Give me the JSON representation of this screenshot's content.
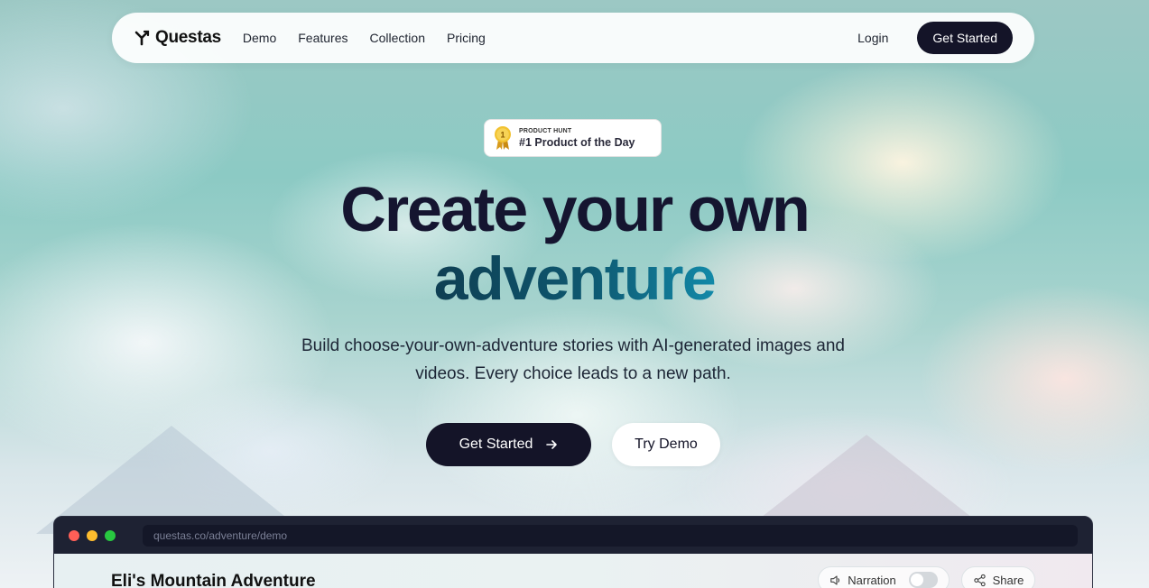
{
  "nav": {
    "logo_text": "Questas",
    "links": [
      "Demo",
      "Features",
      "Collection",
      "Pricing"
    ],
    "login": "Login",
    "cta": "Get Started"
  },
  "badge": {
    "small": "PRODUCT HUNT",
    "big": "#1 Product of the Day",
    "medal_number": "1"
  },
  "hero": {
    "title_line1": "Create your own",
    "title_line2": "adventure",
    "subtitle_line1": "Build choose-your-own-adventure stories with AI-generated images and",
    "subtitle_line2": "videos. Every choice leads to a new path.",
    "primary_button": "Get Started",
    "secondary_button": "Try Demo"
  },
  "browser": {
    "url": "questas.co/adventure/demo",
    "story_title": "Eli's Mountain Adventure",
    "narration_label": "Narration",
    "narration_on": false,
    "share_label": "Share"
  },
  "colors": {
    "primary_dark": "#141428",
    "title_gradient_start": "#0f3f53",
    "title_gradient_end": "#1289a8",
    "dot_red": "#ff5f57",
    "dot_yellow": "#febc2e",
    "dot_green": "#28c840"
  }
}
